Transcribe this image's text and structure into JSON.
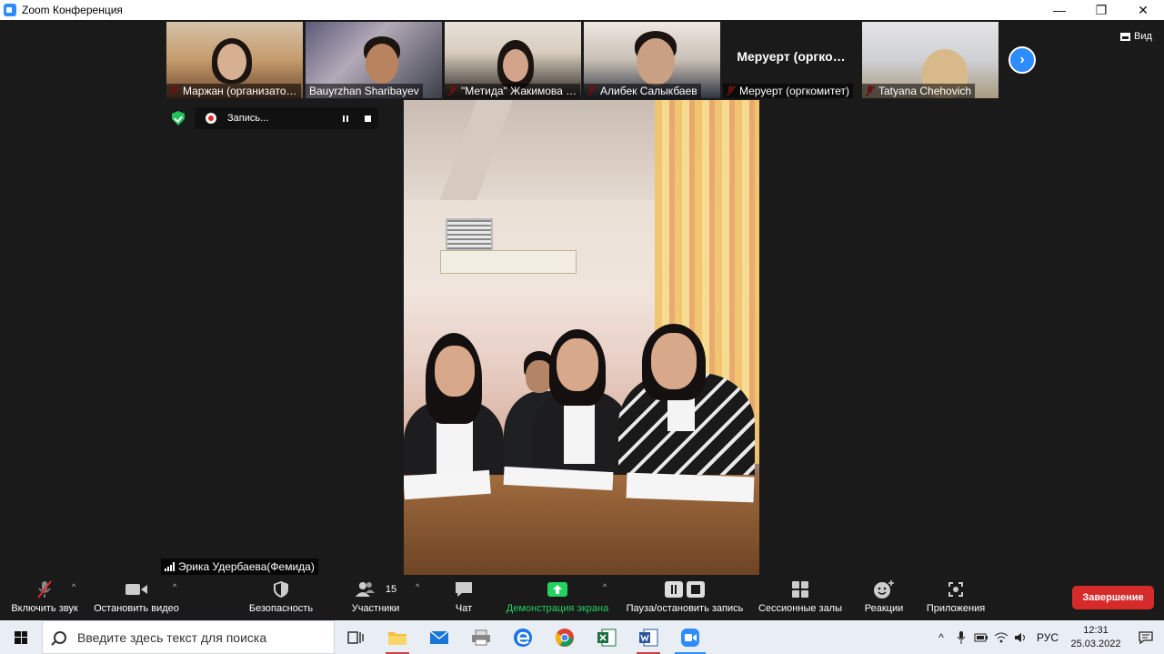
{
  "window": {
    "title": "Zoom Конференция"
  },
  "participants_strip": [
    {
      "name": "Маржан (организато…",
      "muted": true
    },
    {
      "name": "Bauyrzhan Sharibayev",
      "muted": false
    },
    {
      "name": "\"Метида\" Жакимова …",
      "muted": true
    },
    {
      "name": "Алибек Салыкбаев",
      "muted": true
    },
    {
      "name": "Меруерт (оргкомитет)",
      "muted": true,
      "video_off_name": "Меруерт (оргко…"
    },
    {
      "name": "Tatyana Chehovich",
      "muted": true
    }
  ],
  "view_button": {
    "label": "Вид"
  },
  "recording": {
    "label": "Запись..."
  },
  "active_speaker": {
    "name": "Эрика Удербаева(Фемида)"
  },
  "toolbar": {
    "unmute": "Включить звук",
    "stop_video": "Остановить видео",
    "security": "Безопасность",
    "participants": "Участники",
    "participants_count": "15",
    "chat": "Чат",
    "share_screen": "Демонстрация экрана",
    "pause_record": "Пауза/остановить запись",
    "breakout": "Сессионные залы",
    "reactions": "Реакции",
    "apps": "Приложения",
    "end": "Завершение"
  },
  "taskbar": {
    "search_placeholder": "Введите здесь текст для поиска",
    "lang": "РУС",
    "time": "12:31",
    "date": "25.03.2022"
  },
  "colors": {
    "accent": "#2d8cff",
    "end_button": "#d62b2b",
    "share_green": "#23d160",
    "mute_red": "#e02828"
  }
}
